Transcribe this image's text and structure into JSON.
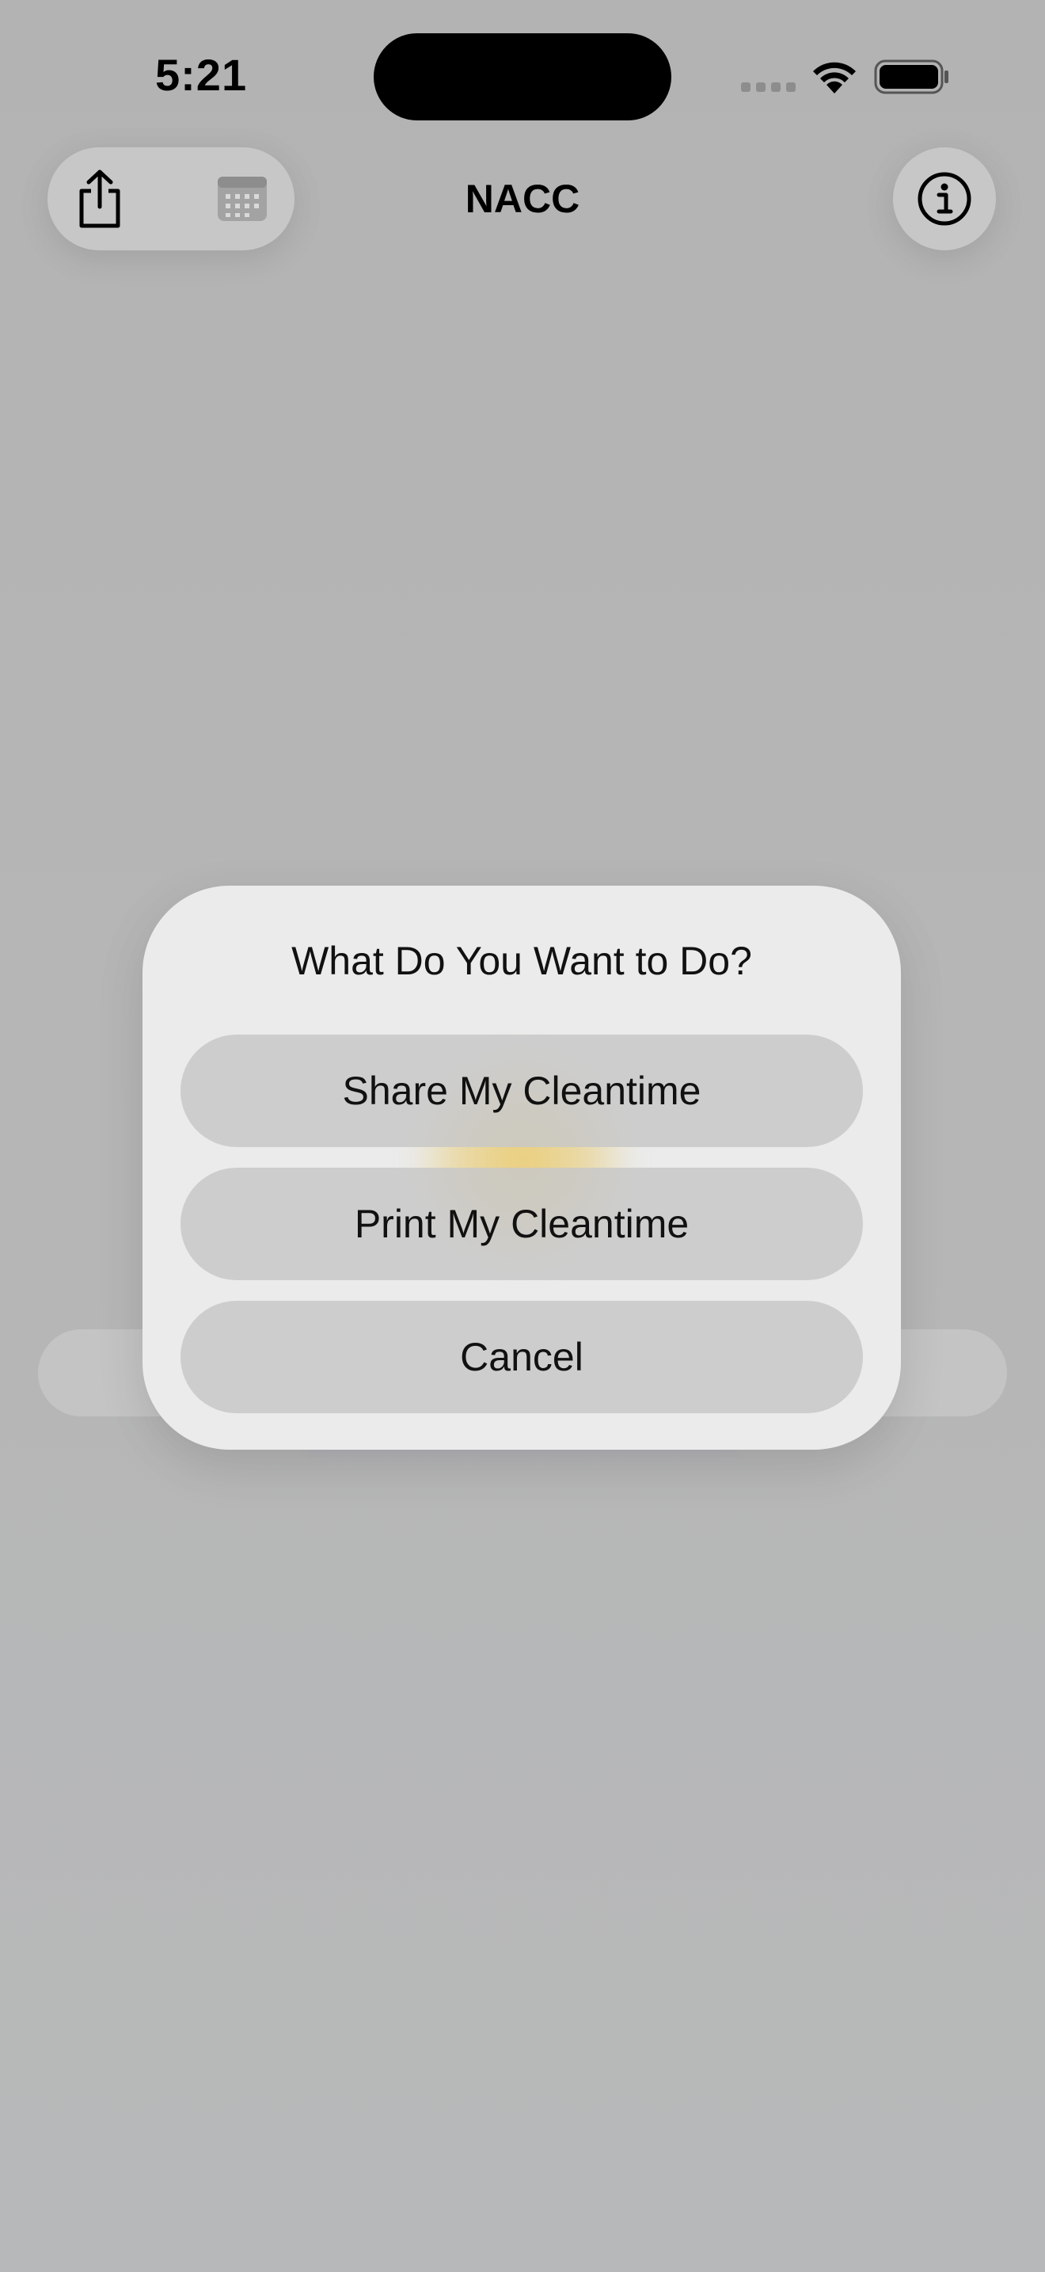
{
  "status_bar": {
    "time": "5:21"
  },
  "nav": {
    "title": "NACC",
    "share_icon": "share-icon",
    "calendar_icon": "calendar-icon",
    "info_icon": "info-icon"
  },
  "alert": {
    "title": "What Do You Want to Do?",
    "buttons": {
      "share": "Share My Cleantime",
      "print": "Print My Cleantime",
      "cancel": "Cancel"
    }
  },
  "colors": {
    "background_dim": "#b4b5b6",
    "alert_background": "#ebebeb",
    "button_background": "#c8c8c8"
  }
}
